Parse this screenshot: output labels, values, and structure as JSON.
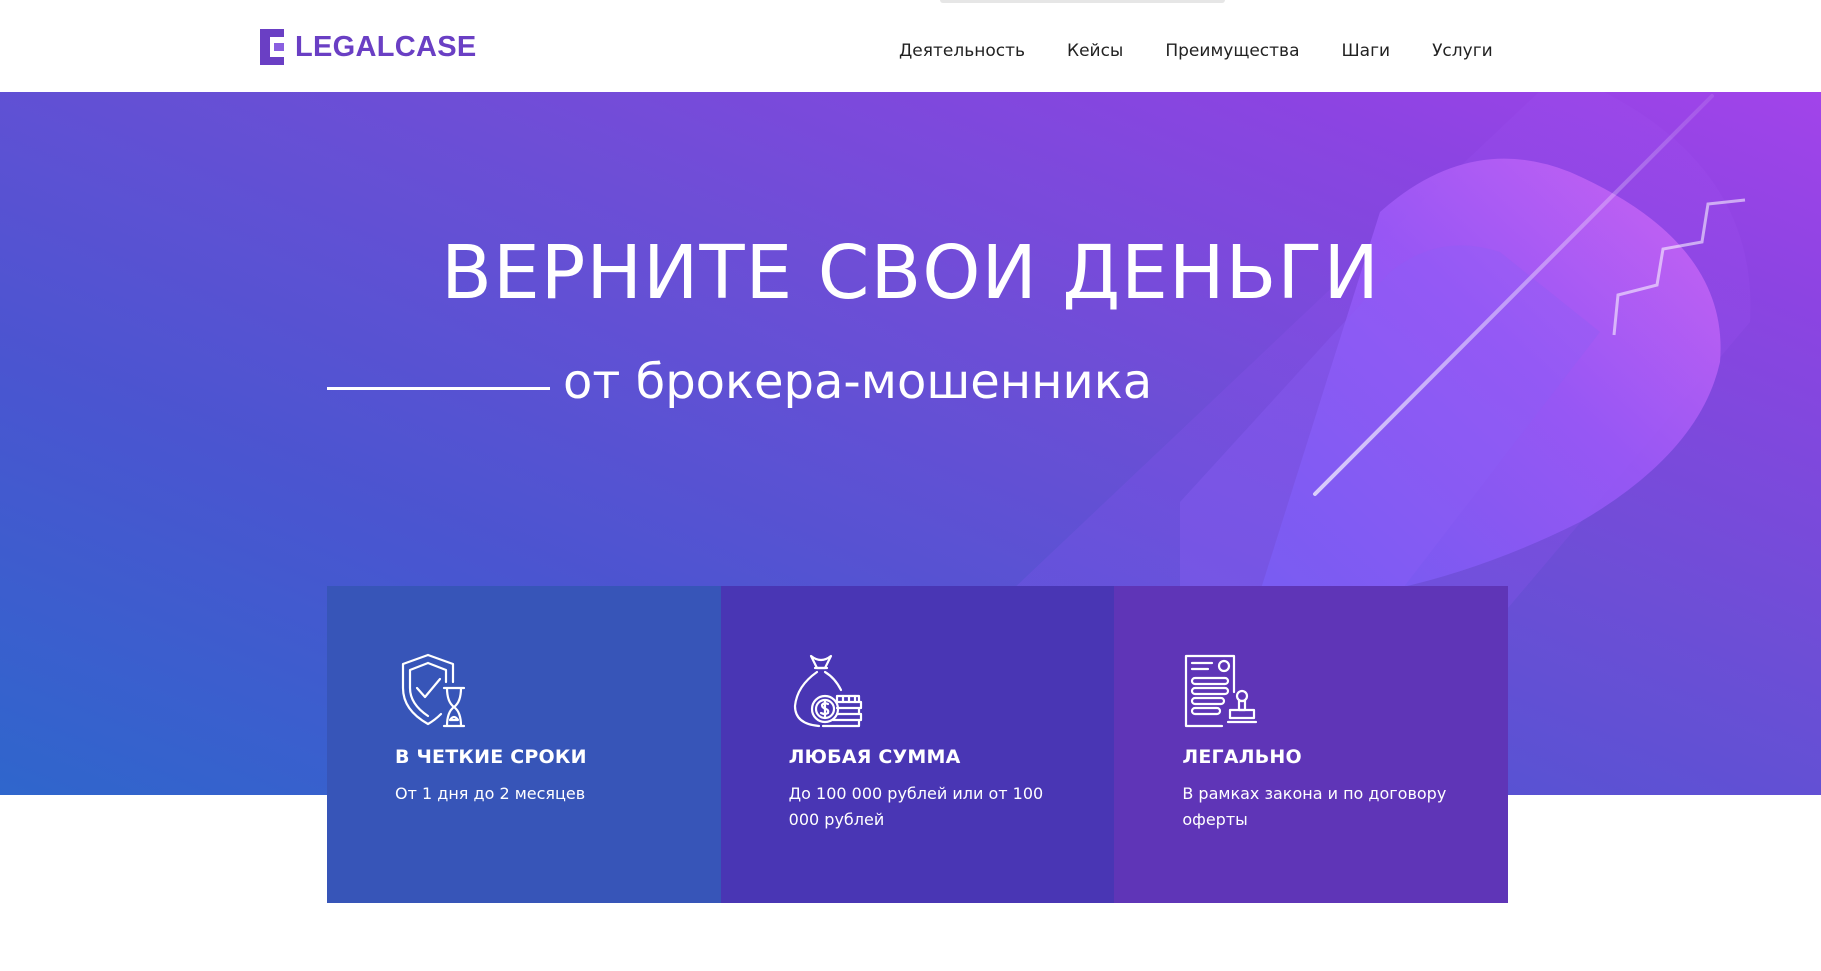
{
  "header": {
    "logo_text": "LEGALCASE",
    "nav": [
      "Деятельность",
      "Кейсы",
      "Преимущества",
      "Шаги",
      "Услуги"
    ]
  },
  "hero": {
    "title": "ВЕРНИТЕ СВОИ ДЕНЬГИ",
    "subtitle": "от брокера-мошенника"
  },
  "features": [
    {
      "icon": "shield-hourglass-icon",
      "title": "В ЧЕТКИЕ СРОКИ",
      "text": "От 1 дня до 2 месяцев"
    },
    {
      "icon": "money-bag-coins-icon",
      "title": "ЛЮБАЯ СУММА",
      "text": "До 100 000 рублей или от 100 000 рублей"
    },
    {
      "icon": "document-stamp-icon",
      "title": "ЛЕГАЛЬНО",
      "text": "В рамках закона и по договору оферты"
    }
  ],
  "colors": {
    "brand": "#6a3fc4",
    "hero_start": "#2f66cc",
    "hero_end": "#a244ea",
    "card_1": "#3755b8",
    "card_2": "#4936b4",
    "card_3": "#5f35b7"
  }
}
